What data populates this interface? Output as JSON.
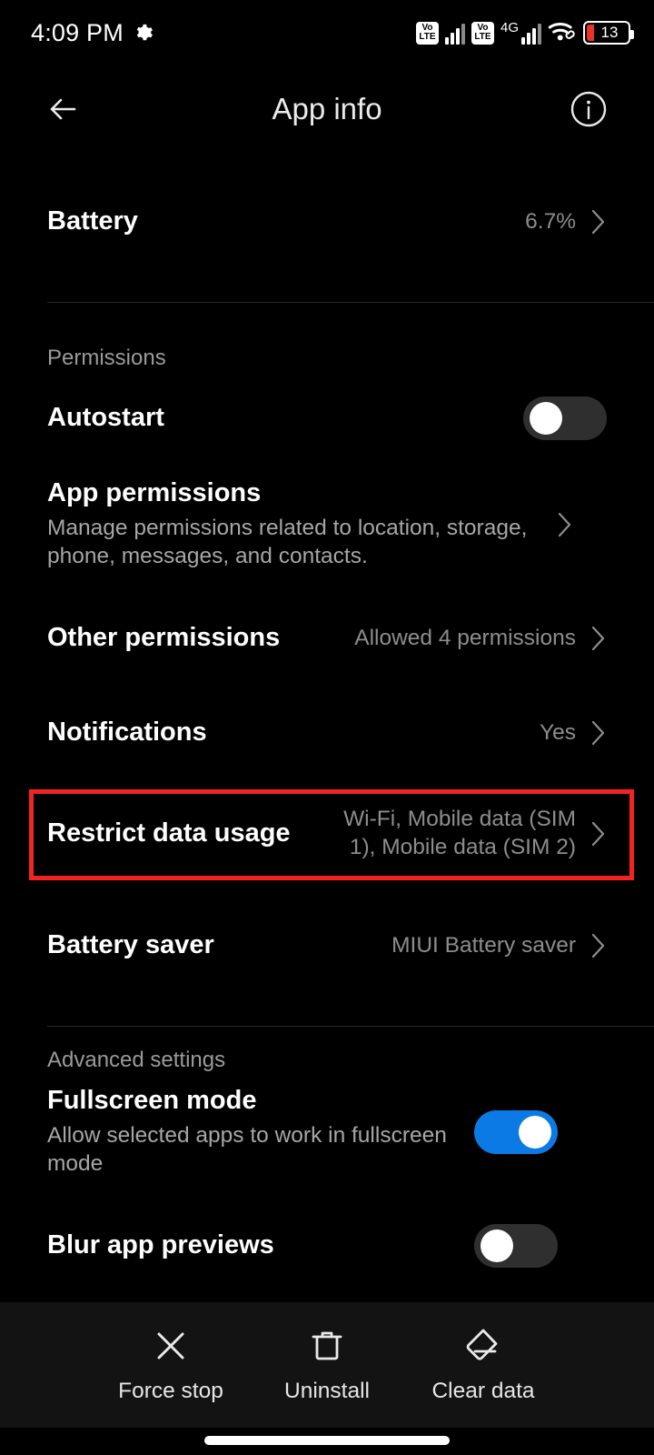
{
  "status_bar": {
    "time": "4:09 PM",
    "gear_icon": "gear-icon",
    "volte1": {
      "top": "Vo",
      "bottom": "LTE"
    },
    "volte2": {
      "top": "Vo",
      "bottom": "LTE"
    },
    "network_label": "4G",
    "wifi_icon": "wifi-icon",
    "battery_percent": "13"
  },
  "header": {
    "title": "App info",
    "back_icon": "back-arrow-icon",
    "info_icon": "info-circle-icon"
  },
  "rows": {
    "battery": {
      "title": "Battery",
      "value": "6.7%"
    },
    "permissions_label": "Permissions",
    "autostart": {
      "title": "Autostart",
      "toggle": "off"
    },
    "app_permissions": {
      "title": "App permissions",
      "subtitle": "Manage permissions related to location, storage, phone, messages, and contacts."
    },
    "other_permissions": {
      "title": "Other permissions",
      "value": "Allowed 4 permissions"
    },
    "notifications": {
      "title": "Notifications",
      "value": "Yes"
    },
    "restrict_data_usage": {
      "title": "Restrict data usage",
      "value": "Wi-Fi, Mobile data (SIM 1), Mobile data (SIM 2)",
      "highlighted": true
    },
    "battery_saver": {
      "title": "Battery saver",
      "value": "MIUI Battery saver"
    },
    "advanced_label": "Advanced settings",
    "fullscreen_mode": {
      "title": "Fullscreen mode",
      "subtitle": "Allow selected apps to work in fullscreen mode",
      "toggle": "on"
    },
    "blur_app_previews": {
      "title": "Blur app previews",
      "toggle": "off"
    }
  },
  "bottom_actions": [
    {
      "label": "Force stop",
      "icon": "close-x-icon"
    },
    {
      "label": "Uninstall",
      "icon": "trash-icon"
    },
    {
      "label": "Clear data",
      "icon": "eraser-icon"
    }
  ],
  "colors": {
    "background": "#000000",
    "highlight_box": "#f42222",
    "toggle_on": "#0b7ae4",
    "toggle_off": "#2f2f2f",
    "bottom_bar": "#131313",
    "battery_low": "#e8332a"
  }
}
